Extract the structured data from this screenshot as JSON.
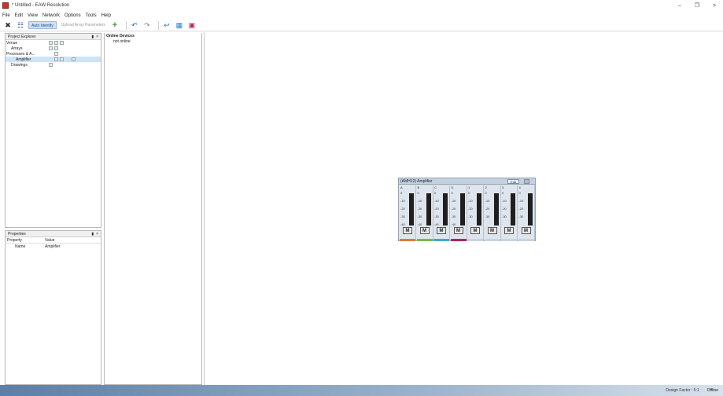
{
  "window": {
    "title": "* Untitled - EAW Resolution"
  },
  "menu": [
    "File",
    "Edit",
    "View",
    "Network",
    "Options",
    "Tools",
    "Help"
  ],
  "toolbar": {
    "auto_identify": "Auto Identify",
    "upload_array": "Upload Array Parameters"
  },
  "project_explorer": {
    "title": "Project Explorer",
    "items": [
      {
        "label": "Venue"
      },
      {
        "label": "Arrays"
      },
      {
        "label": "Processes & A..."
      },
      {
        "label": "Amplifier"
      },
      {
        "label": "Drawings"
      }
    ]
  },
  "online_devices": {
    "title": "Online Devices",
    "status": "not online"
  },
  "properties": {
    "title": "Properties",
    "col_property": "Property",
    "col_value": "Value",
    "rows": [
      {
        "name": "Name",
        "value": "Amplifier"
      }
    ]
  },
  "amplifier": {
    "title": "(AMH12) Amplifier",
    "edit_label": "Edit",
    "channels": [
      {
        "label": "A",
        "ticks": [
          "0",
          "-10",
          "-20",
          "-30",
          "-40"
        ],
        "mute": "M",
        "color": "#e07b39"
      },
      {
        "label": "B",
        "ticks": [
          "0",
          "-10",
          "-20",
          "-30",
          "-40"
        ],
        "mute": "M",
        "color": "#79b84a"
      },
      {
        "label": "C",
        "ticks": [
          "0",
          "-10",
          "-20",
          "-30",
          "-40"
        ],
        "mute": "M",
        "color": "#3fa9d6"
      },
      {
        "label": "D",
        "ticks": [
          "0",
          "-10",
          "-20",
          "-30",
          "-40"
        ],
        "mute": "M",
        "color": "#b0265a"
      },
      {
        "label": "1",
        "ticks": [
          "0",
          "-10",
          "-20",
          "-30"
        ],
        "mute": "M",
        "color": "#c9d3dd"
      },
      {
        "label": "2",
        "ticks": [
          "0",
          "-10",
          "-20",
          "-30"
        ],
        "mute": "M",
        "color": "#c9d3dd"
      },
      {
        "label": "3",
        "ticks": [
          "0",
          "-10",
          "-20",
          "-30"
        ],
        "mute": "M",
        "color": "#c9d3dd"
      },
      {
        "label": "4",
        "ticks": [
          "0",
          "-10",
          "-20",
          "-30"
        ],
        "mute": "M",
        "color": "#c9d3dd"
      }
    ]
  },
  "status": {
    "design_factor": "Design Factor : 5:1",
    "connection": "Offline"
  }
}
